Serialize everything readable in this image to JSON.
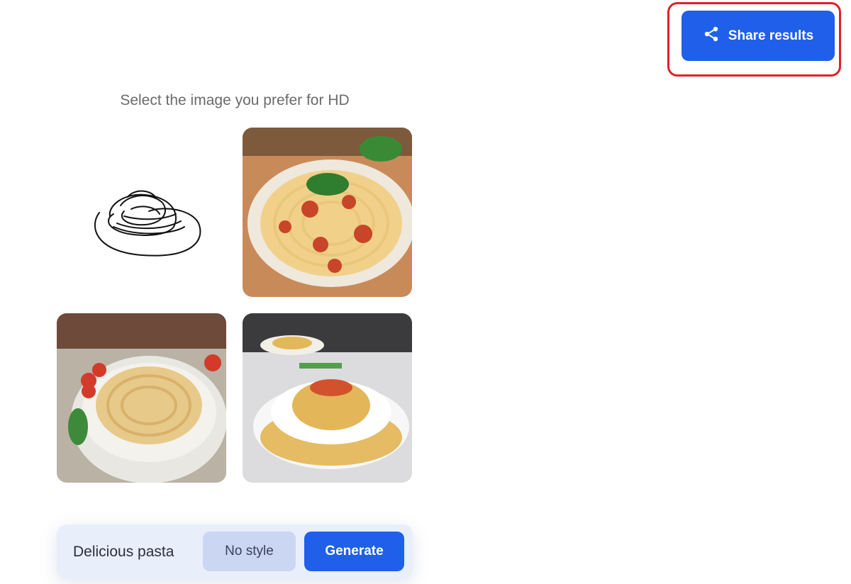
{
  "header": {
    "share_label": "Share results",
    "share_icon": "share-icon"
  },
  "selection": {
    "title": "Select the image you prefer for HD",
    "images": [
      {
        "name": "sketch",
        "kind": "user drawing"
      },
      {
        "name": "result-1",
        "kind": "generated image"
      },
      {
        "name": "result-2",
        "kind": "generated image"
      },
      {
        "name": "result-3",
        "kind": "generated image"
      }
    ]
  },
  "prompt_bar": {
    "prompt": "Delicious pasta",
    "style_label": "No style",
    "generate_label": "Generate"
  },
  "colors": {
    "accent": "#1f5fea",
    "highlight": "#e0202a",
    "bar_background": "#e9eefb",
    "style_button": "#cbd6f3"
  }
}
